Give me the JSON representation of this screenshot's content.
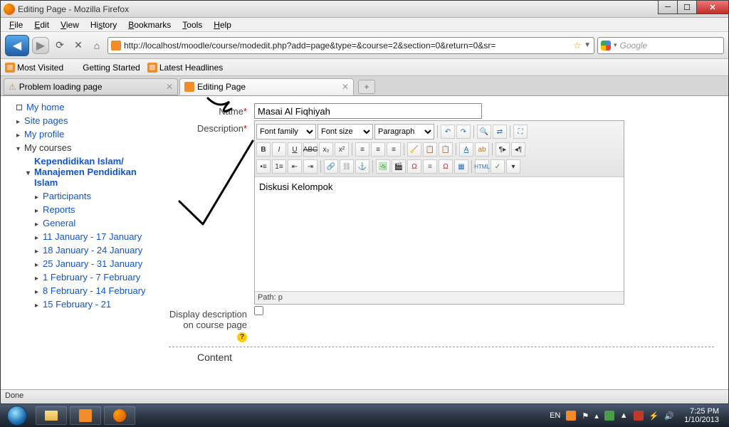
{
  "window_title": "Editing Page - Mozilla Firefox",
  "menus": {
    "file": "File",
    "edit": "Edit",
    "view": "View",
    "history": "History",
    "bookmarks": "Bookmarks",
    "tools": "Tools",
    "help": "Help"
  },
  "url": "http://localhost/moodle/course/modedit.php?add=page&type=&course=2&section=0&return=0&sr=",
  "search_placeholder": "Google",
  "bookmarks": {
    "most_visited": "Most Visited",
    "getting_started": "Getting Started",
    "latest_headlines": "Latest Headlines"
  },
  "tabs": {
    "t1": "Problem loading page",
    "t2": "Editing Page"
  },
  "sidebar": {
    "my_home": "My home",
    "site_pages": "Site pages",
    "my_profile": "My profile",
    "my_courses": "My courses",
    "course_name": "Kependidikan Islam/ Manajemen Pendidikan Islam",
    "items": [
      "Participants",
      "Reports",
      "General",
      "11 January - 17 January",
      "18 January - 24 January",
      "25 January - 31 January",
      "1 February - 7 February",
      "8 February - 14 February",
      "15 February - 21"
    ]
  },
  "form": {
    "name_label": "Name",
    "name_value": "Masai Al Fiqhiyah",
    "desc_label": "Description",
    "font_family": "Font family",
    "font_size": "Font size",
    "paragraph": "Paragraph",
    "desc_value": "Diskusi Kelompok",
    "path": "Path: p",
    "display_label": "Display description on course page",
    "content_heading": "Content"
  },
  "status": "Done",
  "tray": {
    "lang": "EN",
    "time": "7:25 PM",
    "date": "1/10/2013"
  }
}
